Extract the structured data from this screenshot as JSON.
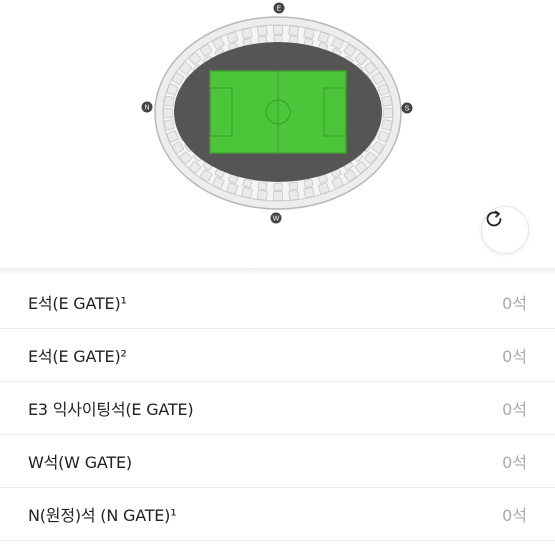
{
  "stadium_map": {
    "gate_markers": {
      "north": "E",
      "south": "W",
      "west": "N",
      "east": "S"
    },
    "pitch_color": "#4cc53a",
    "field_color": "#555555",
    "seat_color": "#eeeeee"
  },
  "refresh_button": {
    "icon": "refresh-icon"
  },
  "sections": [
    {
      "name": "E석(E GATE)¹",
      "count": "0석"
    },
    {
      "name": "E석(E GATE)²",
      "count": "0석"
    },
    {
      "name": "E3 익사이팅석(E GATE)",
      "count": "0석"
    },
    {
      "name": "W석(W GATE)",
      "count": "0석"
    },
    {
      "name": "N(원정)석 (N GATE)¹",
      "count": "0석"
    }
  ]
}
